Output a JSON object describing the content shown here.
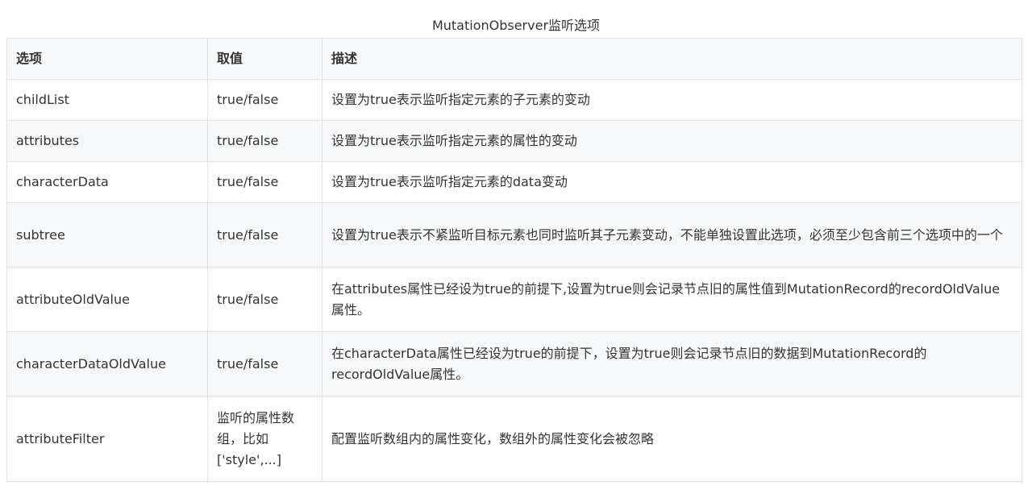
{
  "caption": "MutationObserver监听选项",
  "table": {
    "headers": [
      "选项",
      "取值",
      "描述"
    ],
    "rows": [
      {
        "option": "childList",
        "value": "true/false",
        "desc": "设置为true表示监听指定元素的子元素的变动"
      },
      {
        "option": "attributes",
        "value": "true/false",
        "desc": "设置为true表示监听指定元素的属性的变动"
      },
      {
        "option": "characterData",
        "value": "true/false",
        "desc": "设置为true表示监听指定元素的data变动"
      },
      {
        "option": "subtree",
        "value": "true/false",
        "desc": "设置为true表示不紧监听目标元素也同时监听其子元素变动，不能单独设置此选项，必须至少包含前三个选项中的一个"
      },
      {
        "option": "attributeOldValue",
        "value": "true/false",
        "desc": "在attributes属性已经设为true的前提下,设置为true则会记录节点旧的属性值到MutationRecord的recordOldValue属性。"
      },
      {
        "option": "characterDataOldValue",
        "value": "true/false",
        "desc": "在characterData属性已经设为true的前提下，设置为true则会记录节点旧的数据到MutationRecord的recordOldValue属性。"
      },
      {
        "option": "attributeFilter",
        "value": "监听的属性数组，比如['style',...]",
        "desc": "配置监听数组内的属性变化，数组外的属性变化会被忽略"
      }
    ]
  }
}
